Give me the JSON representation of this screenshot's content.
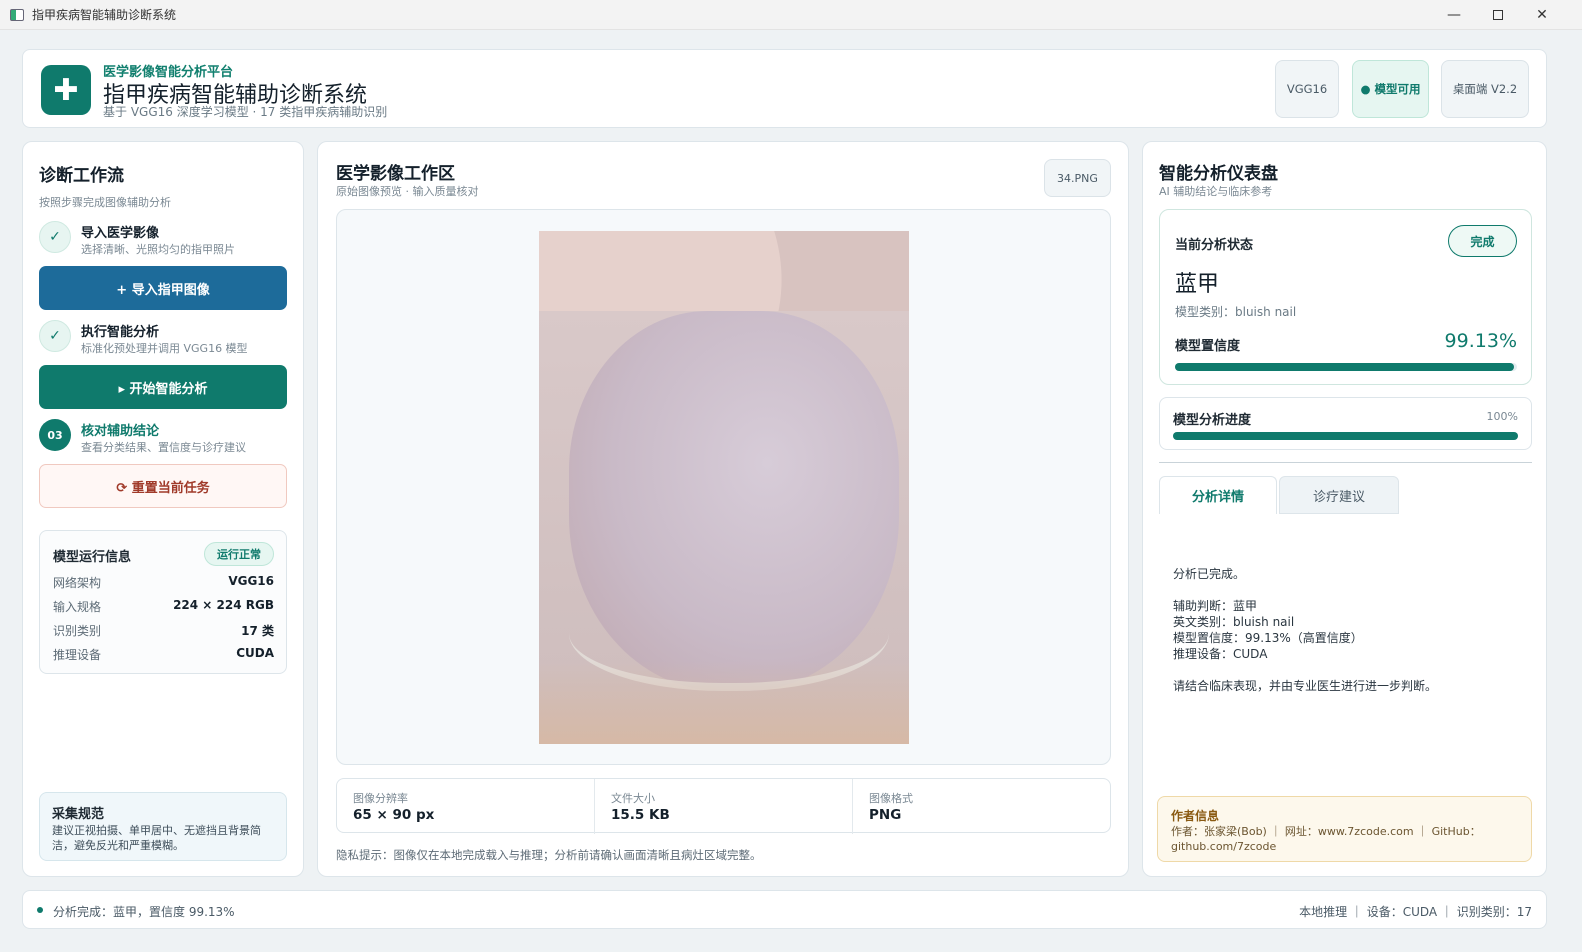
{
  "window": {
    "title": "指甲疾病智能辅助诊断系统",
    "min_icon": "minimize-icon",
    "max_icon": "maximize-icon",
    "close_icon": "close-icon"
  },
  "header": {
    "kicker": "医学影像智能分析平台",
    "title": "指甲疾病智能辅助诊断系统",
    "subtitle": "基于 VGG16 深度学习模型 · 17 类指甲疾病辅助识别",
    "badges": {
      "model": "VGG16",
      "status": "● 模型可用",
      "version": "桌面端 V2.2"
    },
    "logo_icon": "medical-cross-icon",
    "accent": "#0f7a6c"
  },
  "workflow": {
    "title": "诊断工作流",
    "subtitle": "按照步骤完成图像辅助分析",
    "steps": [
      {
        "icon": "✓",
        "title": "导入医学影像",
        "desc": "选择清晰、光照均匀的指甲照片"
      },
      {
        "icon": "✓",
        "title": "执行智能分析",
        "desc": "标准化预处理并调用 VGG16 模型"
      },
      {
        "icon": "03",
        "title": "核对辅助结论",
        "desc": "查看分类结果、置信度与诊疗建议"
      }
    ],
    "import_button": "+  导入指甲图像",
    "analyze_button": "▸  开始智能分析",
    "reset_button": "⟳  重置当前任务",
    "model_info": {
      "title": "模型运行信息",
      "badge": "运行正常",
      "rows": [
        {
          "k": "网络架构",
          "v": "VGG16"
        },
        {
          "k": "输入规格",
          "v": "224 × 224 RGB"
        },
        {
          "k": "识别类别",
          "v": "17 类"
        },
        {
          "k": "推理设备",
          "v": "CUDA"
        }
      ]
    },
    "guide": {
      "title": "采集规范",
      "text": "建议正视拍摄、单甲居中、无遮挡且背景简洁，避免反光和严重模糊。"
    }
  },
  "workspace": {
    "title": "医学影像工作区",
    "subtitle": "原始图像预览 · 输入质量核对",
    "filename": "34.PNG",
    "meta": [
      {
        "label": "图像分辨率",
        "value": "65 × 90 px"
      },
      {
        "label": "文件大小",
        "value": "15.5 KB"
      },
      {
        "label": "图像格式",
        "value": "PNG"
      }
    ],
    "privacy": "隐私提示：图像仅在本地完成载入与推理；分析前请确认画面清晰且病灶区域完整。"
  },
  "dashboard": {
    "title": "智能分析仪表盘",
    "subtitle": "AI 辅助结论与临床参考",
    "status_label": "当前分析状态",
    "status_badge": "完成",
    "diagnosis": "蓝甲",
    "model_class": "模型类别：bluish nail",
    "confidence_label": "模型置信度",
    "confidence_text": "99.13%",
    "confidence": 99.13,
    "progress_label": "模型分析进度",
    "progress_text": "100%",
    "progress": 100,
    "tabs": [
      "分析详情",
      "诊疗建议"
    ],
    "details": [
      "分析已完成。",
      "",
      "辅助判断：蓝甲",
      "英文类别：bluish nail",
      "模型置信度：99.13%（高置信度）",
      "推理设备：CUDA",
      "",
      "请结合临床表现，并由专业医生进行进一步判断。"
    ],
    "author": {
      "title": "作者信息",
      "text": "作者：张家梁(Bob) ｜ 网址：www.7zcode.com ｜ GitHub：github.com/7zcode"
    }
  },
  "statusbar": {
    "left": "分析完成：蓝甲，置信度 99.13%",
    "right": "本地推理 ｜ 设备：CUDA ｜ 识别类别：17"
  }
}
